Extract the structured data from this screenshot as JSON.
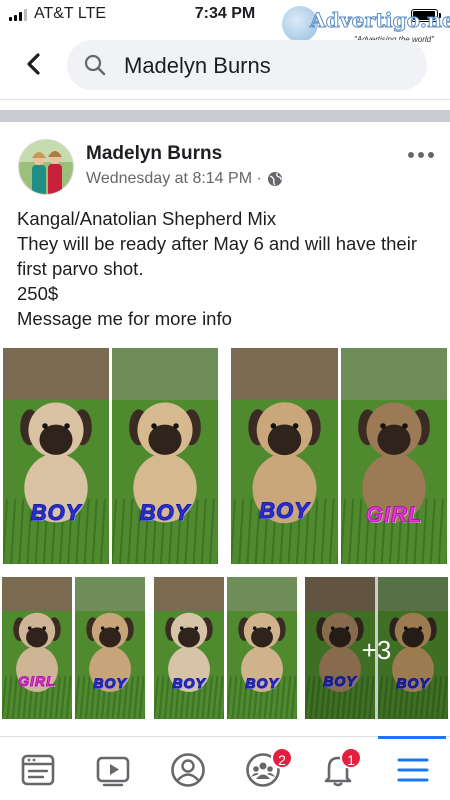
{
  "status_bar": {
    "carrier": "AT&T  LTE",
    "time": "7:34 PM",
    "signal_bars": 3,
    "battery_level": 0.95
  },
  "watermark": {
    "brand": "Advertigo.net",
    "tagline": "\"Advertising the world\""
  },
  "search": {
    "query": "Madelyn Burns",
    "icon": "search-icon"
  },
  "post": {
    "author": "Madelyn Burns",
    "timestamp": "Wednesday at 8:14 PM ·",
    "audience_icon": "globe-icon",
    "body_lines": [
      "Kangal/Anatolian Shepherd Mix",
      "They will be ready after May 6 and will have their first parvo shot.",
      "250$",
      "Message me for more info"
    ],
    "photos_top": [
      {
        "label": "BOY",
        "kind": "boy"
      },
      {
        "label": "BOY",
        "kind": "boy"
      },
      {
        "label": "BOY",
        "kind": "boy"
      },
      {
        "label": "GIRL",
        "kind": "girl"
      }
    ],
    "photos_bottom": [
      {
        "label": "GIRL",
        "kind": "girl"
      },
      {
        "label": "BOY",
        "kind": "boy"
      },
      {
        "label": "BOY",
        "kind": "boy"
      },
      {
        "label": "BOY",
        "kind": "boy"
      },
      {
        "label": "BOY",
        "kind": "boy"
      },
      {
        "label": "BOY",
        "kind": "boy"
      }
    ],
    "more_photos": "+3"
  },
  "bottom_nav": {
    "tabs": [
      {
        "name": "news-feed",
        "icon": "feed-icon"
      },
      {
        "name": "watch",
        "icon": "video-icon"
      },
      {
        "name": "profile",
        "icon": "profile-icon"
      },
      {
        "name": "groups",
        "icon": "groups-icon",
        "badge": "2"
      },
      {
        "name": "notifications",
        "icon": "bell-icon",
        "badge": "1"
      },
      {
        "name": "menu",
        "icon": "menu-icon",
        "active": true
      }
    ]
  },
  "colors": {
    "accent": "#1877f2",
    "badge": "#e41e3f",
    "grass": "#4f8a2f",
    "boy_label": "#2b2fd1",
    "girl_label": "#e43ad0"
  }
}
